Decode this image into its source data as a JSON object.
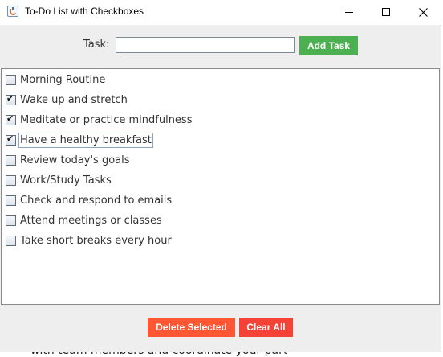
{
  "window": {
    "title": "To-Do List with Checkboxes",
    "minimize_icon": "minimize-icon",
    "maximize_icon": "maximize-icon",
    "close_icon": "close-icon",
    "app_icon": "java-cup-icon"
  },
  "form": {
    "task_label": "Task:",
    "task_value": "",
    "add_button_label": "Add Task"
  },
  "tasks": [
    {
      "label": "Morning Routine",
      "checked": false
    },
    {
      "label": "Wake up and stretch",
      "checked": true
    },
    {
      "label": "Meditate or practice mindfulness",
      "checked": true
    },
    {
      "label": "Have a healthy breakfast",
      "checked": true,
      "focused": true
    },
    {
      "label": "Review today's goals",
      "checked": false
    },
    {
      "label": "Work/Study Tasks",
      "checked": false
    },
    {
      "label": "Check and respond to emails",
      "checked": false
    },
    {
      "label": "Attend meetings or classes",
      "checked": false
    },
    {
      "label": "Take short breaks every hour",
      "checked": false
    }
  ],
  "actions": {
    "delete_label": "Delete Selected",
    "clear_label": "Clear All"
  },
  "background": {
    "partial_text": "with team members and coordinate your part"
  },
  "colors": {
    "add_button": "#4caf50",
    "delete_button": "#ff5733",
    "clear_button": "#f44336"
  }
}
